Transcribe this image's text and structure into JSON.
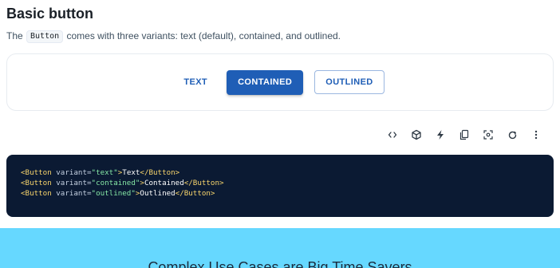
{
  "section": {
    "title": "Basic button",
    "description_before": "The ",
    "description_code": "Button",
    "description_after": " comes with three variants: text (default), contained, and outlined."
  },
  "demo": {
    "text_button": "TEXT",
    "contained_button": "CONTAINED",
    "outlined_button": "OUTLINED"
  },
  "toolbar": {
    "icons": [
      "code-icon",
      "codesandbox-icon",
      "stackblitz-icon",
      "copy-icon",
      "focus-icon",
      "reset-icon",
      "more-vert-icon"
    ]
  },
  "code": {
    "lines": [
      {
        "open_tag": "<Button",
        "attr": " variant=",
        "value": "\"text\"",
        "close": ">",
        "content": "Text",
        "end_tag": "</Button>"
      },
      {
        "open_tag": "<Button",
        "attr": " variant=",
        "value": "\"contained\"",
        "close": ">",
        "content": "Contained",
        "end_tag": "</Button>"
      },
      {
        "open_tag": "<Button",
        "attr": " variant=",
        "value": "\"outlined\"",
        "close": ">",
        "content": "Outlined",
        "end_tag": "</Button>"
      }
    ]
  },
  "banner": {
    "text": "Complex Use Cases are Big Time Savers"
  },
  "colors": {
    "primary": "#1f5eb6",
    "code_background": "#0b1a33",
    "banner_background": "#66d8ff"
  }
}
